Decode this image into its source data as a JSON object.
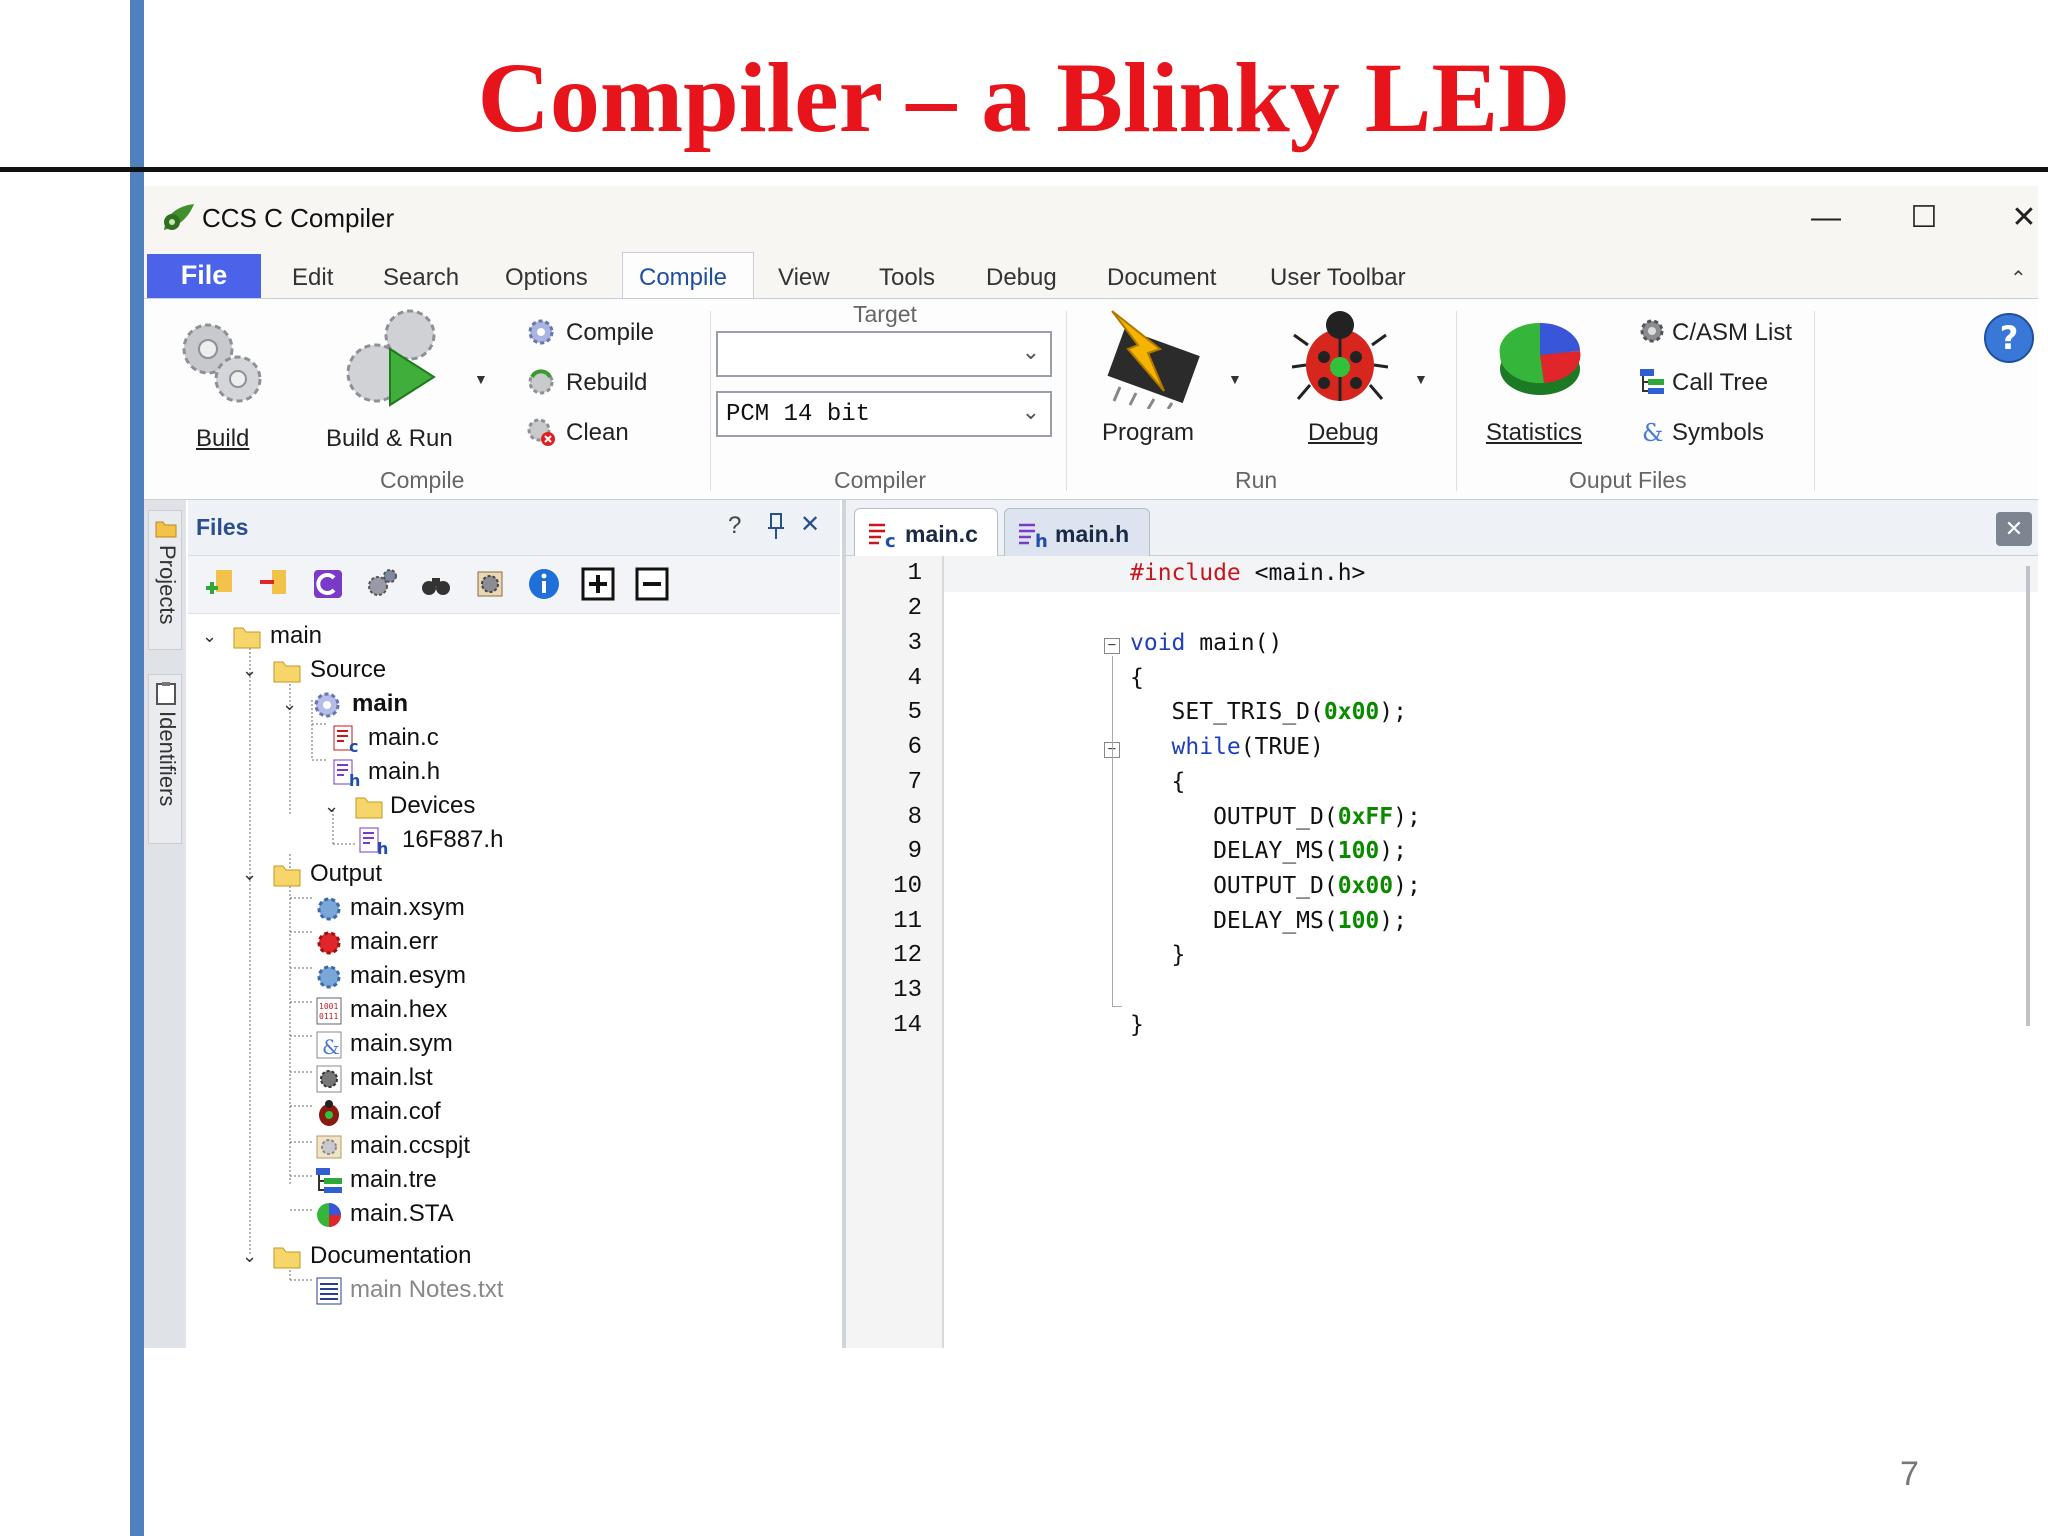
{
  "slide": {
    "title": "Compiler – a Blinky LED",
    "page_number": "7"
  },
  "window": {
    "title": "CCS C Compiler",
    "controls": {
      "minimize": "—",
      "maximize": "☐",
      "close": "✕"
    }
  },
  "menu": {
    "file": "File",
    "items": [
      "Edit",
      "Search",
      "Options",
      "Compile",
      "View",
      "Tools",
      "Debug",
      "Document",
      "User Toolbar"
    ],
    "active": "Compile"
  },
  "ribbon": {
    "compile_group": {
      "label": "Compile",
      "build": "Build",
      "build_run": "Build & Run",
      "compile": "Compile",
      "rebuild": "Rebuild",
      "clean": "Clean"
    },
    "compiler_group": {
      "label": "Compiler",
      "target_label": "Target",
      "target_value": "",
      "compiler_value": "PCM 14 bit"
    },
    "run_group": {
      "label": "Run",
      "program": "Program",
      "debug": "Debug"
    },
    "output_group": {
      "label": "Ouput Files",
      "statistics": "Statistics",
      "asm_list": "C/ASM List",
      "call_tree": "Call Tree",
      "symbols": "Symbols"
    }
  },
  "side_tabs": {
    "projects": "Projects",
    "identifiers": "Identifiers"
  },
  "files_panel": {
    "title": "Files",
    "controls": {
      "help": "?",
      "pin": "ᵖ",
      "close": "✕"
    },
    "tree": {
      "root": "main",
      "source": "Source",
      "main_unit": "main",
      "main_c": "main.c",
      "main_h": "main.h",
      "devices": "Devices",
      "device_file": "16F887.h",
      "output": "Output",
      "output_files": [
        "main.xsym",
        "main.err",
        "main.esym",
        "main.hex",
        "main.sym",
        "main.lst",
        "main.cof",
        "main.ccspjt",
        "main.tre",
        "main.STA"
      ],
      "documentation": "Documentation",
      "notes_file": "main Notes.txt"
    }
  },
  "editor": {
    "tabs": [
      "main.c",
      "main.h"
    ],
    "active_tab": "main.c",
    "line_numbers": [
      "1",
      "2",
      "3",
      "4",
      "5",
      "6",
      "7",
      "8",
      "9",
      "10",
      "11",
      "12",
      "13",
      "14"
    ]
  },
  "colors": {
    "title_red": "#e8141b",
    "side_rule": "#4f81bd",
    "file_menu": "#4a63e8",
    "keyword": "#1f3fbf",
    "number": "#0b8a00",
    "preprocessor": "#c8161d"
  }
}
